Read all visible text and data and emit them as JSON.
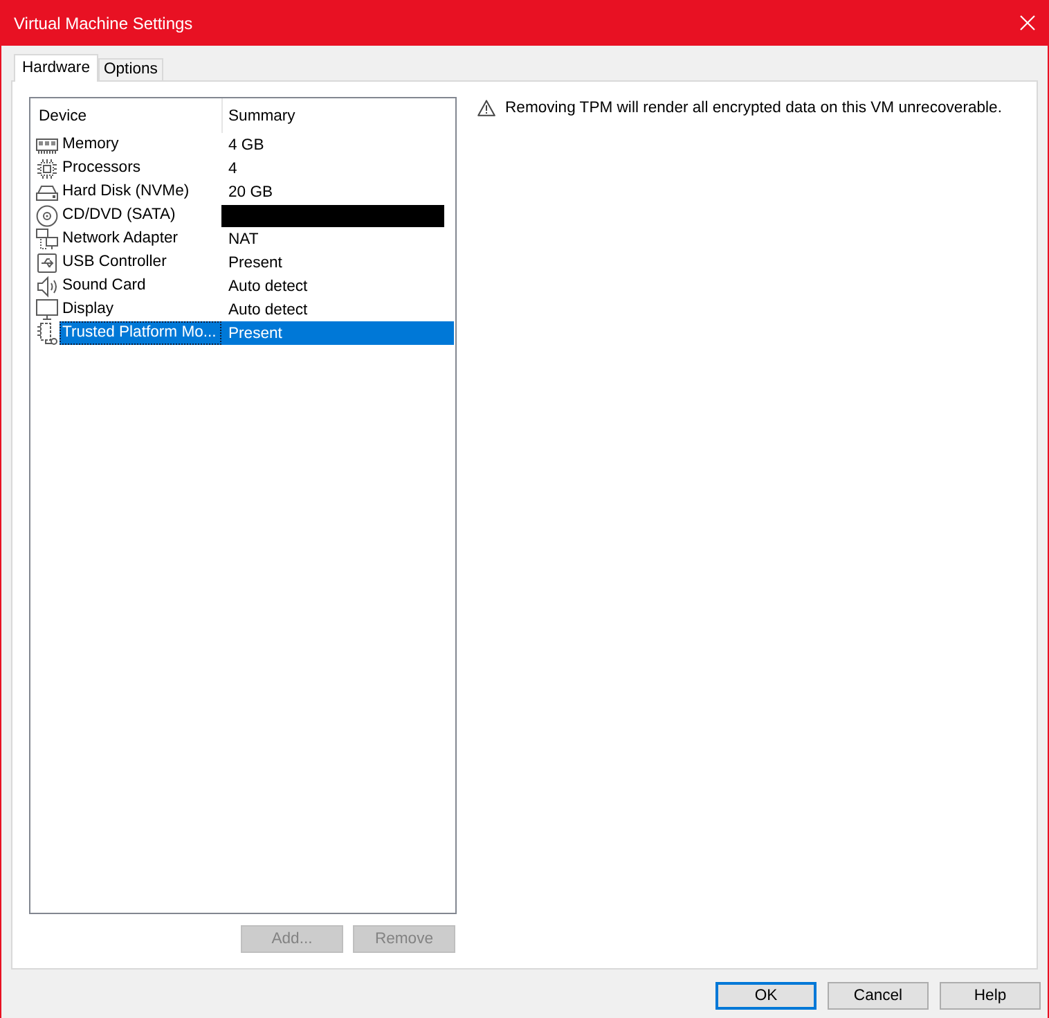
{
  "window": {
    "title": "Virtual Machine Settings"
  },
  "tabs": [
    {
      "label": "Hardware",
      "selected": true
    },
    {
      "label": "Options",
      "selected": false
    }
  ],
  "device_list": {
    "columns": [
      "Device",
      "Summary"
    ],
    "rows": [
      {
        "kind": "memory",
        "device": "Memory",
        "summary": "4 GB",
        "redacted": false,
        "selected": false
      },
      {
        "kind": "processor",
        "device": "Processors",
        "summary": "4",
        "redacted": false,
        "selected": false
      },
      {
        "kind": "disk",
        "device": "Hard Disk (NVMe)",
        "summary": "20 GB",
        "redacted": false,
        "selected": false
      },
      {
        "kind": "cdrom",
        "device": "CD/DVD (SATA)",
        "redacted": true,
        "selected": false
      },
      {
        "kind": "network",
        "device": "Network Adapter",
        "summary": "NAT",
        "redacted": false,
        "selected": false
      },
      {
        "kind": "usb",
        "device": "USB Controller",
        "summary": "Present",
        "redacted": false,
        "selected": false
      },
      {
        "kind": "sound",
        "device": "Sound Card",
        "summary": "Auto detect",
        "redacted": false,
        "selected": false
      },
      {
        "kind": "display",
        "device": "Display",
        "summary": "Auto detect",
        "redacted": false,
        "selected": false
      },
      {
        "kind": "tpm",
        "device": "Trusted Platform Mo...",
        "summary": "Present",
        "redacted": false,
        "selected": true
      }
    ]
  },
  "list_buttons": [
    {
      "label": "Add...",
      "disabled": true
    },
    {
      "label": "Remove",
      "disabled": true
    }
  ],
  "message": {
    "text": "Removing TPM will render all encrypted data on this VM unrecoverable."
  },
  "dialog_buttons": [
    {
      "label": "OK",
      "default": true
    },
    {
      "label": "Cancel",
      "default": false
    },
    {
      "label": "Help",
      "default": false
    }
  ]
}
